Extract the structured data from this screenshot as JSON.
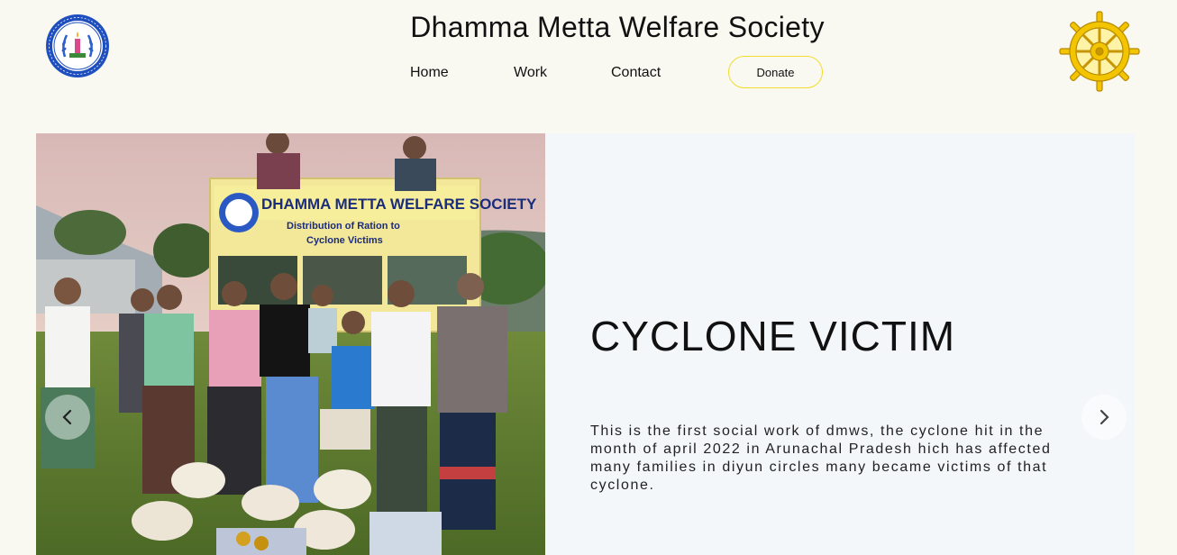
{
  "header": {
    "title": "Dhamma Metta Welfare Society",
    "nav": {
      "home": "Home",
      "work": "Work",
      "contact": "Contact",
      "donate": "Donate"
    },
    "left_logo_icon": "society-emblem-icon",
    "right_logo_icon": "dharma-wheel-icon",
    "accent_color": "#f2dd2c"
  },
  "slide": {
    "title": "CYCLONE VICTIM",
    "description": "This is the first social work of dmws, the cyclone hit in the month of april 2022 in Arunachal Pradesh hich has affected many families in diyun circles many became victims of that cyclone.",
    "photo": {
      "banner_title": "DHAMMA METTA WELFARE SOCIETY",
      "banner_subtitle_1": "Distribution of Ration to",
      "banner_subtitle_2": "Cyclone Victims"
    },
    "prev_icon": "chevron-left-icon",
    "next_icon": "chevron-right-icon"
  }
}
